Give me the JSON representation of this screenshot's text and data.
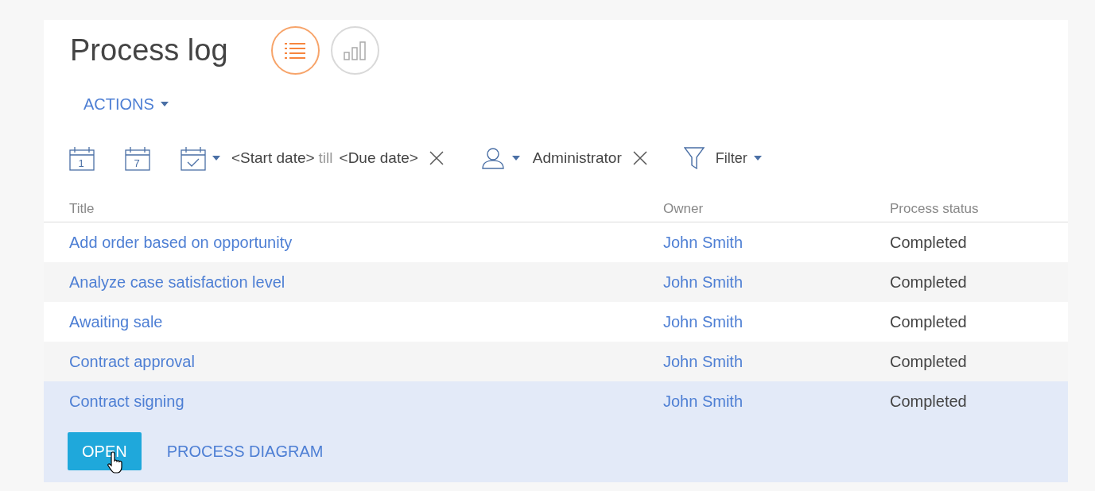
{
  "title": "Process log",
  "views": [
    {
      "kind": "list",
      "selected": true
    },
    {
      "kind": "chart",
      "selected": false
    }
  ],
  "actions": {
    "label": "ACTIONS"
  },
  "filters": {
    "day_icon": "1",
    "week_icon": "7",
    "start": "<Start date>",
    "till": "till",
    "due": "<Due date>",
    "owner": "Administrator",
    "filter": "Filter"
  },
  "table": {
    "columns": [
      "Title",
      "Owner",
      "Process status"
    ],
    "rows": [
      {
        "title": "Add order based on opportunity",
        "owner": "John Smith",
        "status": "Completed",
        "selected": false
      },
      {
        "title": "Analyze case satisfaction level",
        "owner": "John Smith",
        "status": "Completed",
        "selected": false
      },
      {
        "title": "Awaiting sale",
        "owner": "John Smith",
        "status": "Completed",
        "selected": false
      },
      {
        "title": "Contract approval",
        "owner": "John Smith",
        "status": "Completed",
        "selected": false
      },
      {
        "title": "Contract signing",
        "owner": "John Smith",
        "status": "Completed",
        "selected": true
      }
    ],
    "row_buttons": [
      "OPEN",
      "PROCESS DIAGRAM"
    ]
  }
}
